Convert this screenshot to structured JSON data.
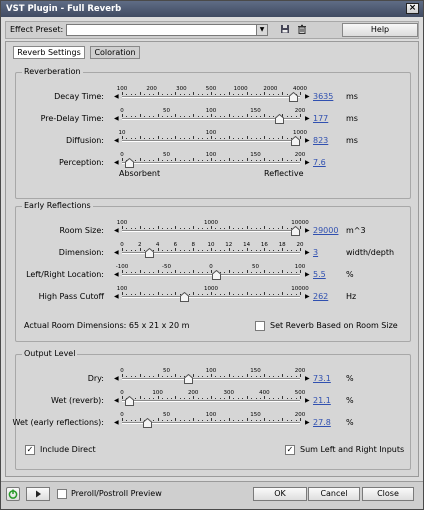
{
  "window": {
    "title": "VST Plugin - Full Reverb",
    "close_glyph": "×"
  },
  "preset": {
    "label": "Effect Preset:",
    "value": "",
    "help": "Help"
  },
  "tabs": [
    "Reverb Settings",
    "Coloration"
  ],
  "groups": {
    "reverberation": {
      "title": "Reverberation",
      "rows": [
        {
          "label": "Decay Time:",
          "ticks": [
            "100",
            "200",
            "300",
            "500",
            "1000",
            "2000",
            "4000"
          ],
          "value": "3635",
          "unit": "ms",
          "level": 0.96
        },
        {
          "label": "Pre-Delay Time:",
          "ticks": [
            "0",
            "50",
            "100",
            "150",
            "200"
          ],
          "value": "177",
          "unit": "ms",
          "level": 0.88
        },
        {
          "label": "Diffusion:",
          "ticks": [
            "10",
            "100",
            "1000"
          ],
          "value": "823",
          "unit": "ms",
          "level": 0.97
        },
        {
          "label": "Perception:",
          "ticks": [
            "0",
            "50",
            "100",
            "150",
            "200"
          ],
          "value": "7.6",
          "unit": "",
          "level": 0.04
        }
      ],
      "perception_left": "Absorbent",
      "perception_right": "Reflective"
    },
    "early": {
      "title": "Early Reflections",
      "rows": [
        {
          "label": "Room Size:",
          "ticks": [
            "100",
            "1000",
            "10000"
          ],
          "value": "29000",
          "unit": "m^3",
          "level": 0.97
        },
        {
          "label": "Dimension:",
          "ticks": [
            "0",
            "2",
            "4",
            "6",
            "8",
            "10",
            "12",
            "14",
            "16",
            "18",
            "20"
          ],
          "value": "3",
          "unit": "width/depth",
          "level": 0.15
        },
        {
          "label": "Left/Right Location:",
          "ticks": [
            "-100",
            "-50",
            "0",
            "50",
            "100"
          ],
          "value": "5.5",
          "unit": "%",
          "level": 0.53
        },
        {
          "label": "High Pass Cutoff",
          "ticks": [
            "100",
            "1000",
            "10000"
          ],
          "value": "262",
          "unit": "Hz",
          "level": 0.35
        }
      ],
      "room_dims": "Actual Room Dimensions: 65 x 21 x 20 m",
      "set_reverb": "Set Reverb Based on Room Size"
    },
    "output": {
      "title": "Output Level",
      "rows": [
        {
          "label": "Dry:",
          "ticks": [
            "0",
            "50",
            "100",
            "150",
            "200"
          ],
          "value": "73.1",
          "unit": "%",
          "level": 0.37
        },
        {
          "label": "Wet (reverb):",
          "ticks": [
            "0",
            "100",
            "200",
            "300",
            "400",
            "500"
          ],
          "value": "21.1",
          "unit": "%",
          "level": 0.04
        },
        {
          "label": "Wet (early reflections):",
          "ticks": [
            "0",
            "50",
            "100",
            "150",
            "200"
          ],
          "value": "27.8",
          "unit": "%",
          "level": 0.14
        }
      ],
      "include_direct": "Include Direct",
      "sum_lr": "Sum Left and Right Inputs"
    }
  },
  "bottom": {
    "preroll": "Preroll/Postroll Preview",
    "ok": "OK",
    "cancel": "Cancel",
    "close": "Close"
  },
  "colors": {
    "accent": "#3050b0",
    "power": "#2a9a2a"
  }
}
